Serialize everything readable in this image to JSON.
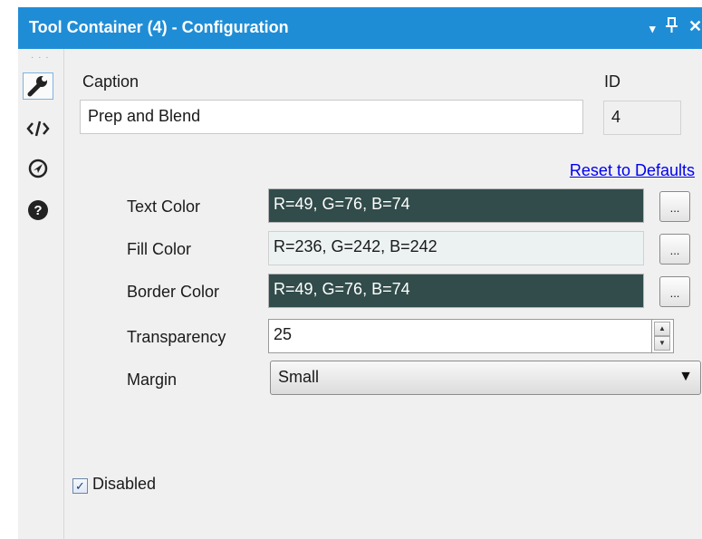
{
  "window": {
    "title": "Tool Container (4) - Configuration",
    "controls": {
      "dropdown": "▾",
      "pin": "⊥",
      "close": "✕"
    }
  },
  "sidebar": {
    "grip": "· · ·",
    "items": [
      {
        "icon": "wrench-icon",
        "active": true
      },
      {
        "icon": "code-icon",
        "glyph": "</>"
      },
      {
        "icon": "target-icon"
      },
      {
        "icon": "help-icon",
        "glyph": "?"
      }
    ]
  },
  "config": {
    "caption_label": "Caption",
    "caption_value": "Prep and Blend",
    "id_label": "ID",
    "id_value": "4",
    "reset_link": "Reset to Defaults",
    "text_color": {
      "label": "Text Color",
      "value": "R=49, G=76, B=74",
      "swatch": "#314c4a"
    },
    "fill_color": {
      "label": "Fill Color",
      "value": "R=236, G=242, B=242",
      "swatch": "#ecf2f2"
    },
    "border_color": {
      "label": "Border Color",
      "value": "R=49, G=76, B=74",
      "swatch": "#314c4a"
    },
    "ellipsis": "...",
    "transparency_label": "Transparency",
    "transparency_value": "25",
    "margin_label": "Margin",
    "margin_value": "Small",
    "disabled": {
      "label": "Disabled",
      "checked": true,
      "mark": "✓"
    }
  },
  "colors": {
    "titlebar": "#1f8dd6",
    "panel": "#f0f0f0",
    "link": "#0000ee"
  }
}
